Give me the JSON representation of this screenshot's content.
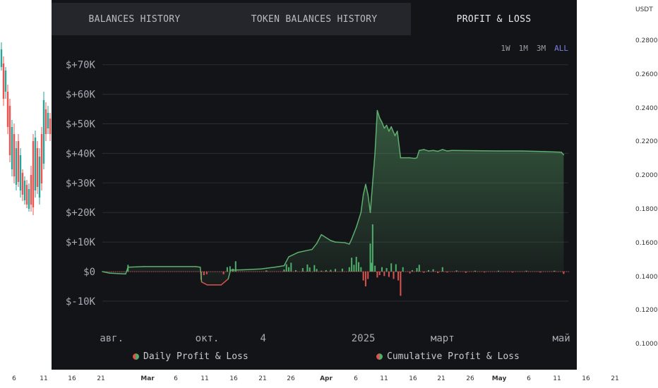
{
  "right_axis": {
    "unit": "USDT",
    "labels": [
      "0.2800",
      "0.2600",
      "0.2400",
      "0.2200",
      "0.2000",
      "0.1800",
      "0.1600",
      "0.1400",
      "0.1200",
      "0.1000"
    ]
  },
  "bottom_axis": {
    "labels": [
      {
        "text": "6",
        "bold": false
      },
      {
        "text": "11",
        "bold": false
      },
      {
        "text": "16",
        "bold": false
      },
      {
        "text": "21",
        "bold": false
      },
      {
        "text": "Mar",
        "bold": true
      },
      {
        "text": "6",
        "bold": false
      },
      {
        "text": "11",
        "bold": false
      },
      {
        "text": "16",
        "bold": false
      },
      {
        "text": "21",
        "bold": false
      },
      {
        "text": "26",
        "bold": false
      },
      {
        "text": "Apr",
        "bold": true
      },
      {
        "text": "6",
        "bold": false
      },
      {
        "text": "11",
        "bold": false
      },
      {
        "text": "16",
        "bold": false
      },
      {
        "text": "21",
        "bold": false
      },
      {
        "text": "26",
        "bold": false
      },
      {
        "text": "May",
        "bold": true
      },
      {
        "text": "6",
        "bold": false
      },
      {
        "text": "11",
        "bold": false
      },
      {
        "text": "16",
        "bold": false
      },
      {
        "text": "21",
        "bold": false
      }
    ]
  },
  "tabs": [
    {
      "label": "BALANCES HISTORY"
    },
    {
      "label": "TOKEN BALANCES HISTORY"
    },
    {
      "label": "PROFIT & LOSS"
    }
  ],
  "range_buttons": [
    {
      "label": "1W"
    },
    {
      "label": "1M"
    },
    {
      "label": "3M"
    },
    {
      "label": "ALL"
    }
  ],
  "legend": {
    "daily": "Daily Profit & Loss",
    "cumulative": "Cumulative Profit & Loss"
  },
  "colors": {
    "panel_bg": "#131418",
    "cumulative_line": "#5fae6e",
    "positive_bar": "#4caf6a",
    "negative_bar": "#d9534f",
    "accent_active": "#7a7fe0"
  },
  "chart_data": {
    "type": "area",
    "ylim": [
      -17000,
      72000
    ],
    "yticks": [
      "$+70K",
      "$+60K",
      "$+50K",
      "$+40K",
      "$+30K",
      "$+20K",
      "$+10K",
      "$0",
      "$-10K"
    ],
    "ytick_values": [
      70000,
      60000,
      50000,
      40000,
      30000,
      20000,
      10000,
      0,
      -10000
    ],
    "xticks": [
      {
        "label": "авг.",
        "t": 0.02
      },
      {
        "label": "окт.",
        "t": 0.225
      },
      {
        "label": "4",
        "t": 0.345
      },
      {
        "label": "2025",
        "t": 0.56
      },
      {
        "label": "март",
        "t": 0.73
      },
      {
        "label": "май",
        "t": 0.985
      }
    ],
    "cumulative": {
      "name": "Cumulative Profit & Loss",
      "points": [
        [
          0.0,
          0
        ],
        [
          0.015,
          -500
        ],
        [
          0.05,
          -800
        ],
        [
          0.055,
          1500
        ],
        [
          0.09,
          1700
        ],
        [
          0.2,
          1700
        ],
        [
          0.21,
          1500
        ],
        [
          0.213,
          -3500
        ],
        [
          0.225,
          -4500
        ],
        [
          0.255,
          -4500
        ],
        [
          0.27,
          -2500
        ],
        [
          0.275,
          500
        ],
        [
          0.3,
          600
        ],
        [
          0.34,
          900
        ],
        [
          0.37,
          1500
        ],
        [
          0.39,
          2000
        ],
        [
          0.4,
          5000
        ],
        [
          0.42,
          6500
        ],
        [
          0.45,
          7500
        ],
        [
          0.46,
          9500
        ],
        [
          0.47,
          12500
        ],
        [
          0.49,
          10500
        ],
        [
          0.5,
          10000
        ],
        [
          0.52,
          9800
        ],
        [
          0.53,
          9300
        ],
        [
          0.535,
          11000
        ],
        [
          0.545,
          15000
        ],
        [
          0.555,
          20000
        ],
        [
          0.56,
          26000
        ],
        [
          0.565,
          29500
        ],
        [
          0.57,
          26000
        ],
        [
          0.575,
          20000
        ],
        [
          0.58,
          30000
        ],
        [
          0.585,
          40000
        ],
        [
          0.59,
          54500
        ],
        [
          0.595,
          52000
        ],
        [
          0.6,
          50500
        ],
        [
          0.605,
          48500
        ],
        [
          0.61,
          49500
        ],
        [
          0.615,
          47500
        ],
        [
          0.62,
          49000
        ],
        [
          0.628,
          46000
        ],
        [
          0.633,
          47500
        ],
        [
          0.64,
          38500
        ],
        [
          0.66,
          38500
        ],
        [
          0.67,
          38300
        ],
        [
          0.675,
          38500
        ],
        [
          0.68,
          41000
        ],
        [
          0.69,
          41300
        ],
        [
          0.7,
          40800
        ],
        [
          0.71,
          41000
        ],
        [
          0.72,
          40700
        ],
        [
          0.73,
          41300
        ],
        [
          0.74,
          40800
        ],
        [
          0.75,
          41000
        ],
        [
          0.8,
          40900
        ],
        [
          0.85,
          40800
        ],
        [
          0.9,
          40800
        ],
        [
          0.95,
          40600
        ],
        [
          0.985,
          40400
        ],
        [
          0.99,
          39500
        ]
      ]
    },
    "daily": {
      "name": "Daily Profit & Loss",
      "bars": [
        [
          0.055,
          2300
        ],
        [
          0.212,
          -2700
        ],
        [
          0.218,
          -1200
        ],
        [
          0.224,
          -900
        ],
        [
          0.26,
          -900
        ],
        [
          0.268,
          1500
        ],
        [
          0.274,
          1800
        ],
        [
          0.28,
          1000
        ],
        [
          0.286,
          3500
        ],
        [
          0.352,
          400
        ],
        [
          0.39,
          700
        ],
        [
          0.395,
          2500
        ],
        [
          0.4,
          1500
        ],
        [
          0.405,
          3000
        ],
        [
          0.415,
          500
        ],
        [
          0.43,
          1200
        ],
        [
          0.44,
          2400
        ],
        [
          0.445,
          1400
        ],
        [
          0.455,
          2200
        ],
        [
          0.46,
          900
        ],
        [
          0.47,
          300
        ],
        [
          0.48,
          500
        ],
        [
          0.49,
          600
        ],
        [
          0.5,
          900
        ],
        [
          0.515,
          1000
        ],
        [
          0.53,
          1500
        ],
        [
          0.535,
          4700
        ],
        [
          0.54,
          2300
        ],
        [
          0.545,
          5000
        ],
        [
          0.55,
          3200
        ],
        [
          0.555,
          1500
        ],
        [
          0.56,
          -3000
        ],
        [
          0.565,
          -5000
        ],
        [
          0.57,
          -2500
        ],
        [
          0.575,
          9500
        ],
        [
          0.578,
          3000
        ],
        [
          0.58,
          16000
        ],
        [
          0.585,
          2000
        ],
        [
          0.59,
          -2000
        ],
        [
          0.595,
          -1200
        ],
        [
          0.6,
          1500
        ],
        [
          0.605,
          -1500
        ],
        [
          0.61,
          1200
        ],
        [
          0.615,
          -1800
        ],
        [
          0.62,
          2800
        ],
        [
          0.625,
          -2500
        ],
        [
          0.63,
          2500
        ],
        [
          0.635,
          -3000
        ],
        [
          0.64,
          -8200
        ],
        [
          0.645,
          1500
        ],
        [
          0.66,
          -600
        ],
        [
          0.665,
          500
        ],
        [
          0.675,
          1200
        ],
        [
          0.68,
          2300
        ],
        [
          0.69,
          -400
        ],
        [
          0.7,
          500
        ],
        [
          0.71,
          800
        ],
        [
          0.72,
          -500
        ],
        [
          0.73,
          1500
        ],
        [
          0.74,
          -300
        ],
        [
          0.76,
          400
        ],
        [
          0.78,
          -400
        ],
        [
          0.8,
          300
        ],
        [
          0.82,
          -300
        ],
        [
          0.85,
          300
        ],
        [
          0.88,
          -300
        ],
        [
          0.91,
          300
        ],
        [
          0.94,
          -300
        ],
        [
          0.97,
          300
        ],
        [
          0.99,
          -800
        ]
      ]
    }
  }
}
